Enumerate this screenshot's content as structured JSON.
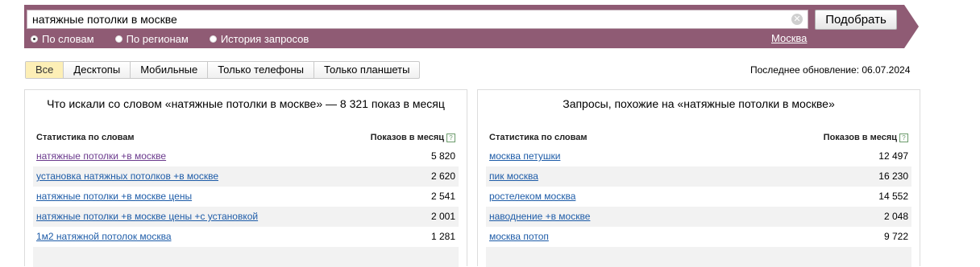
{
  "search": {
    "query": "натяжные потолки в москве",
    "submit_label": "Подобрать",
    "clear_symbol": "✕"
  },
  "modes": [
    {
      "label": "По словам",
      "selected": true
    },
    {
      "label": "По регионам",
      "selected": false
    },
    {
      "label": "История запросов",
      "selected": false
    }
  ],
  "region": "Москва",
  "tabs": [
    "Все",
    "Десктопы",
    "Мобильные",
    "Только телефоны",
    "Только планшеты"
  ],
  "active_tab": "Все",
  "last_update": "Последнее обновление: 06.07.2024",
  "left_panel": {
    "title": "Что искали со словом «натяжные потолки в москве» — 8 321 показ в месяц",
    "col_keyword": "Статистика по словам",
    "col_count": "Показов в месяц",
    "rows": [
      {
        "keyword": "натяжные потолки +в москве",
        "count": "5 820"
      },
      {
        "keyword": "установка натяжных потолков +в москве",
        "count": "2 620"
      },
      {
        "keyword": "натяжные потолки +в москве цены",
        "count": "2 541"
      },
      {
        "keyword": "натяжные потолки +в москве цены +с установкой",
        "count": "2 001"
      },
      {
        "keyword": "1м2 натяжной потолок москва",
        "count": "1 281"
      }
    ]
  },
  "right_panel": {
    "title": "Запросы, похожие на «натяжные потолки в москве»",
    "col_keyword": "Статистика по словам",
    "col_count": "Показов в месяц",
    "rows": [
      {
        "keyword": "москва петушки",
        "count": "12 497"
      },
      {
        "keyword": "пик москва",
        "count": "16 230"
      },
      {
        "keyword": "ростелеком москва",
        "count": "14 552"
      },
      {
        "keyword": "наводнение +в москве",
        "count": "2 048"
      },
      {
        "keyword": "москва потоп",
        "count": "9 722"
      }
    ]
  },
  "help_symbol": "?",
  "colors": {
    "banner": "#8f5b74",
    "link": "#1e5ca8",
    "visited_link": "#6b3a8d",
    "active_tab": "#fdefb6"
  }
}
